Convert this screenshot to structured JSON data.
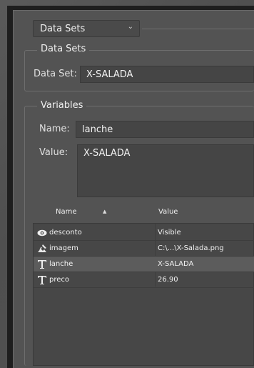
{
  "data_sets_selector": {
    "value": "Data Sets"
  },
  "data_sets_group": {
    "title": "Data Sets",
    "label": "Data Set:",
    "value": "X-SALADA"
  },
  "variables_group": {
    "title": "Variables",
    "name_label": "Name:",
    "name_value": "lanche",
    "value_label": "Value:",
    "value_text": "X-SALADA"
  },
  "table": {
    "headers": {
      "name": "Name",
      "value": "Value"
    },
    "rows": [
      {
        "icon": "eye-icon",
        "name": "desconto",
        "value": "Visible",
        "selected": false
      },
      {
        "icon": "image-brush-icon",
        "name": "imagem",
        "value": "C:\\...\\X-Salada.png",
        "selected": false
      },
      {
        "icon": "text-t-icon",
        "name": "lanche",
        "value": "X-SALADA",
        "selected": true
      },
      {
        "icon": "text-t-icon",
        "name": "preco",
        "value": "26.90",
        "selected": false
      }
    ]
  }
}
